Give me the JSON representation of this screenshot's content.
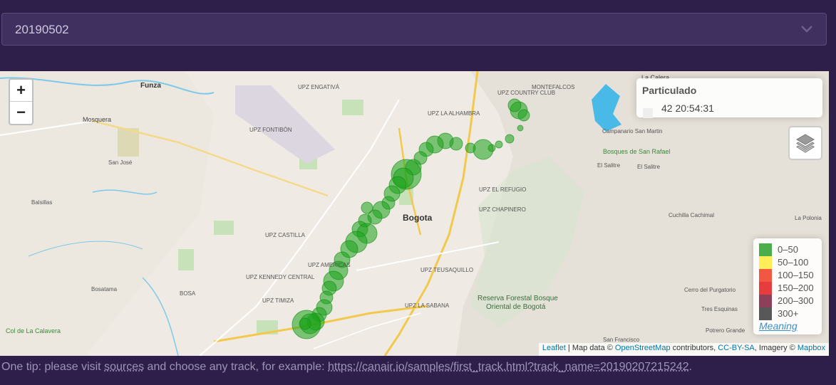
{
  "track_select": {
    "value": "20190502"
  },
  "map": {
    "zoom_in": "+",
    "zoom_out": "−",
    "info_title": "Particulado",
    "info_time": "42 20:54:31",
    "legend": [
      {
        "label": "0–50",
        "color": "#2ca02c"
      },
      {
        "label": "50–100",
        "color": "#ffeb3b"
      },
      {
        "label": "100–150",
        "color": "#f03b20"
      },
      {
        "label": "150–200",
        "color": "#e31a1c"
      },
      {
        "label": "200–300",
        "color": "#7a1f3d"
      },
      {
        "label": "300+",
        "color": "#3b3b3b"
      }
    ],
    "legend_link": "Meaning",
    "attribution": {
      "leaflet": "Leaflet",
      "sep1": " | Map data © ",
      "osm": "OpenStreetMap",
      "contrib": " contributors, ",
      "license": "CC-BY-SA",
      "imagery": ", Imagery © ",
      "mapbox": "Mapbox"
    },
    "place_labels": {
      "bogota": "Bogota",
      "funza": "Funza",
      "mosquera": "Mosquera",
      "la_calera": "La Calera",
      "reserva": "Reserva Forestal Bosque",
      "reserva2": "Oriental de Bogotá",
      "bosatama": "Bosatama",
      "balsillas": "Balsillas",
      "san_jose": "San José",
      "el_salitre": "El Salitre",
      "el_salitre2": "El Salitre",
      "la_polonia": "La Polonia",
      "cuchilla_cachimal": "Cuchilla Cachimal",
      "tres_esquinas": "Tres Esquinas",
      "potrero_grande": "Potrero Grande",
      "san_francisco": "San Francisco",
      "cerro_purgatorio": "Cerro del Purgatorio",
      "campanario": "Campanario San Martin",
      "bosques_san_rafael": "Bosques de San Rafael",
      "col_la_calavera": "Col de La Calavera",
      "upz_chapinero": "UPZ CHAPINERO",
      "upz_teusaquillo": "UPZ TEUSAQUILLO",
      "upz_kennedy": "UPZ KENNEDY CENTRAL",
      "upz_timiza": "UPZ TIMIZA",
      "upz_bosa": "BOSA",
      "upz_fontibon": "UPZ FONTIBÓN",
      "upz_engativa": "UPZ ENGATIVÁ",
      "upz_suba": "UPZ LA ALHAMBRA",
      "upz_castilla": "UPZ CASTILLA",
      "upz_americas": "UPZ AMERICAS",
      "upz_sabana": "UPZ LA SABANA",
      "upz_refugio": "UPZ EL REFUGIO",
      "upz_usaquen": "UPZ COUNTRY CLUB",
      "upz_montebello": "MONTEFALCOS"
    }
  },
  "tip": {
    "before": "One tip: please visit ",
    "sources": "sources",
    "middle": " and choose any track, for example: ",
    "link": "https://canair.io/samples/first_track.html?track_name=20190207215242",
    "after": "."
  }
}
